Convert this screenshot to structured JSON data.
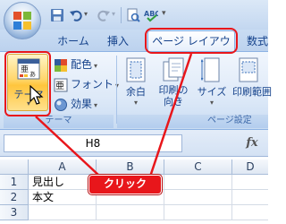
{
  "tabs": [
    {
      "label": "ホーム"
    },
    {
      "label": "挿入"
    },
    {
      "label": "ページ レイアウト"
    },
    {
      "label": "数式"
    }
  ],
  "ribbon": {
    "themes": {
      "label": "テーマ",
      "colors_label": "配色",
      "fonts_label": "フォント",
      "effects_label": "効果",
      "group_label": "テーマ"
    },
    "page_setup": {
      "margins_label": "余白",
      "orientation_label": "印刷の\n向き",
      "size_label": "サイズ",
      "print_area_label": "印刷範囲",
      "group_label": "ページ設定"
    }
  },
  "formula_bar": {
    "name_box": "H8",
    "fx_label": "fx"
  },
  "sheet": {
    "columns": [
      "A",
      "B",
      "C",
      "D"
    ],
    "rows": [
      {
        "num": "1",
        "a": "見出し"
      },
      {
        "num": "2",
        "a": "本文"
      },
      {
        "num": "3",
        "a": ""
      }
    ]
  },
  "callout": {
    "label": "クリック"
  },
  "colors": {
    "highlight": "#e8161b",
    "ribbon_text": "#15428b"
  }
}
